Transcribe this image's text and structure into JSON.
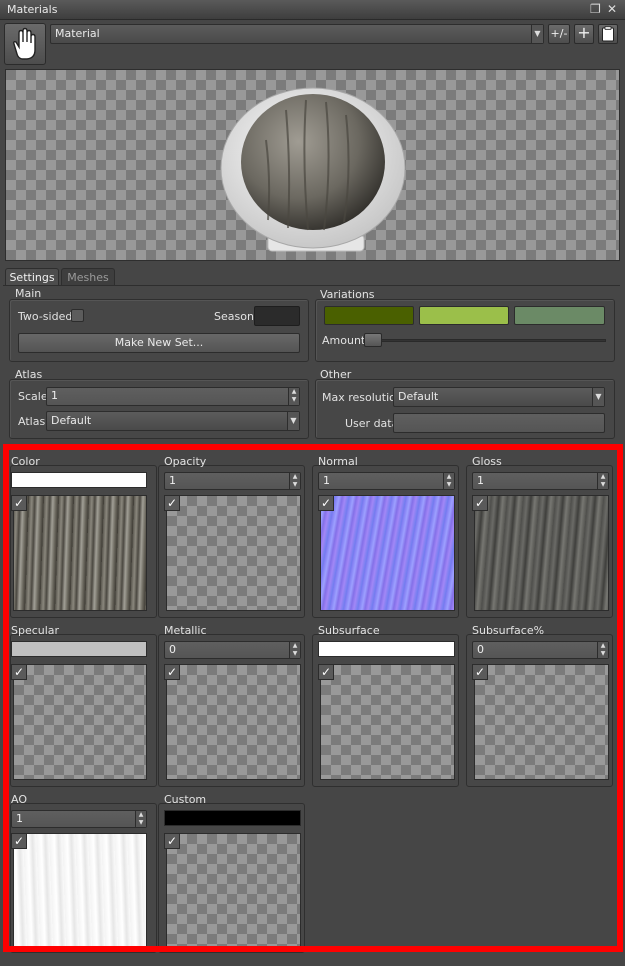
{
  "window": {
    "title": "Materials"
  },
  "toolbar": {
    "material_value": "Material",
    "plus_minus_label": "+/-"
  },
  "tabs": [
    "Settings",
    "Meshes"
  ],
  "main": {
    "title": "Main",
    "two_sided_label": "Two-sided",
    "season_label": "Season",
    "make_new_set_label": "Make New Set..."
  },
  "variations": {
    "title": "Variations",
    "swatches": [
      "#4a6000",
      "#9bbf4a",
      "#6b8a66"
    ],
    "amount_label": "Amount"
  },
  "atlas": {
    "title": "Atlas",
    "scale_label": "Scale",
    "scale_value": "1",
    "atlas_label": "Atlas",
    "atlas_value": "Default"
  },
  "other": {
    "title": "Other",
    "max_resolution_label": "Max resolution",
    "max_resolution_value": "Default",
    "user_data_label": "User data",
    "user_data_value": ""
  },
  "channels": [
    {
      "label": "Color",
      "control": "color",
      "swatch": "#ffffff",
      "checked": true,
      "texture": "bark"
    },
    {
      "label": "Opacity",
      "control": "spin",
      "value": "1",
      "checked": true,
      "texture": "none"
    },
    {
      "label": "Normal",
      "control": "spin",
      "value": "1",
      "checked": true,
      "texture": "normal"
    },
    {
      "label": "Gloss",
      "control": "spin",
      "value": "1",
      "checked": true,
      "texture": "gloss"
    },
    {
      "label": "Specular",
      "control": "color",
      "swatch": "#c0c0c0",
      "checked": true,
      "texture": "none"
    },
    {
      "label": "Metallic",
      "control": "spin",
      "value": "0",
      "checked": true,
      "texture": "none"
    },
    {
      "label": "Subsurface",
      "control": "color",
      "swatch": "#ffffff",
      "checked": true,
      "texture": "none"
    },
    {
      "label": "Subsurface%",
      "control": "spin",
      "value": "0",
      "checked": true,
      "texture": "none"
    },
    {
      "label": "AO",
      "control": "spin",
      "value": "1",
      "checked": true,
      "texture": "ao"
    },
    {
      "label": "Custom",
      "control": "color",
      "swatch": "#000000",
      "checked": true,
      "texture": "none"
    }
  ],
  "highlight_color": "#ff0000",
  "icons": [
    "hand-icon",
    "restore-icon",
    "close-icon",
    "add-icon",
    "clipboard-icon",
    "checkmark-icon",
    "spin-arrows-icon",
    "dropdown-arrow-icon"
  ]
}
